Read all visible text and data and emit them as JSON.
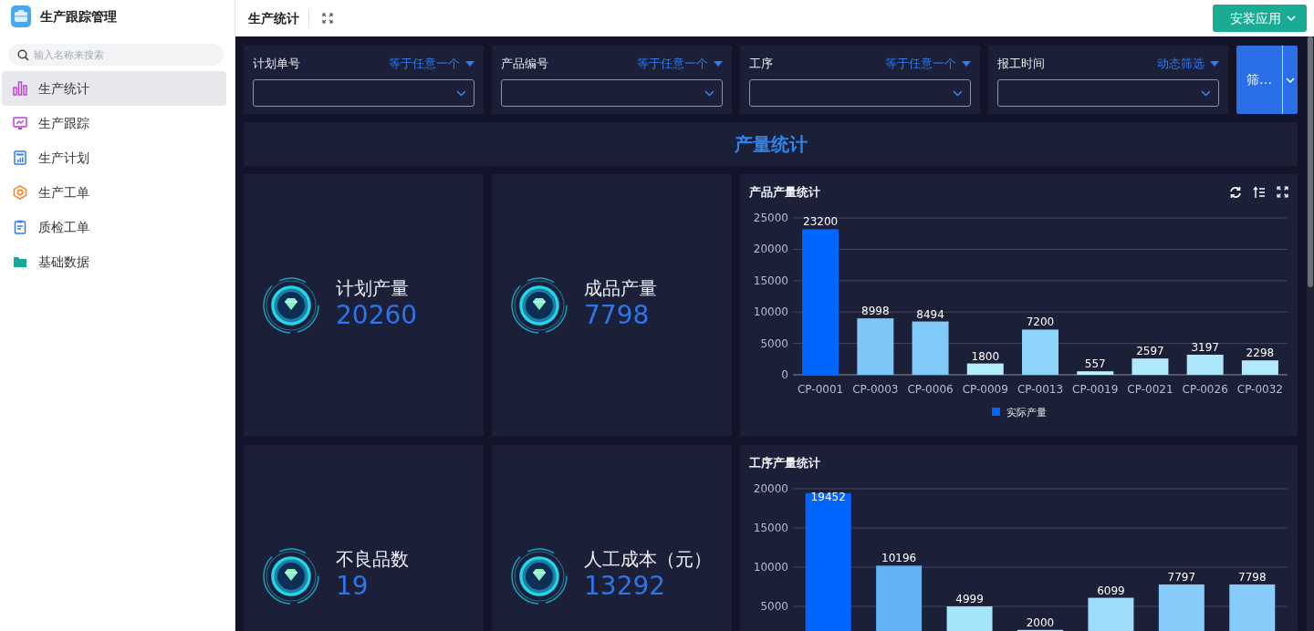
{
  "app": {
    "title": "生产跟踪管理"
  },
  "search": {
    "placeholder": "输入名称来搜索"
  },
  "sidebar": {
    "items": [
      {
        "label": "生产统计",
        "selected": true
      },
      {
        "label": "生产跟踪",
        "selected": false
      },
      {
        "label": "生产计划",
        "selected": false
      },
      {
        "label": "生产工单",
        "selected": false
      },
      {
        "label": "质检工单",
        "selected": false
      },
      {
        "label": "基础数据",
        "selected": false
      }
    ]
  },
  "header": {
    "title": "生产统计",
    "button": "安装应用"
  },
  "filters": [
    {
      "label": "计划单号",
      "operator": "等于任意一个"
    },
    {
      "label": "产品编号",
      "operator": "等于任意一个"
    },
    {
      "label": "工序",
      "operator": "等于任意一个"
    },
    {
      "label": "报工时间",
      "operator": "动态筛选"
    }
  ],
  "filter_button": "筛…",
  "section_title": "产量统计",
  "stats": [
    {
      "label": "计划产量",
      "value": "20260"
    },
    {
      "label": "成品产量",
      "value": "7798"
    },
    {
      "label": "不良品数",
      "value": "19"
    },
    {
      "label": "人工成本（元）",
      "value": "13292"
    }
  ],
  "charts": [
    {
      "title": "产品产量统计",
      "chart_data": {
        "type": "bar",
        "categories": [
          "CP-0001",
          "CP-0003",
          "CP-0006",
          "CP-0009",
          "CP-0013",
          "CP-0019",
          "CP-0021",
          "CP-0026",
          "CP-0032"
        ],
        "series": [
          {
            "name": "实际产量",
            "color": "#0066ff",
            "colors": [
              "#0066ff",
              "#7cc6f8",
              "#80c9f9",
              "#b4ecfb",
              "#8dd3fa",
              "#b8f0fb",
              "#b0e9fb",
              "#abe6fb",
              "#b1eafb"
            ],
            "values": [
              23200,
              8998,
              8494,
              1800,
              7200,
              557,
              2597,
              3197,
              2298
            ]
          }
        ],
        "ylim": [
          0,
          25000
        ],
        "yticks": [
          0,
          5000,
          10000,
          15000,
          20000,
          25000
        ],
        "grid": true,
        "data_labels": true
      }
    },
    {
      "title": "工序产量统计",
      "chart_data": {
        "type": "bar",
        "series": [
          {
            "colors": [
              "#0066ff",
              "#64b2f6",
              "#a6e4fb",
              "#b8f0fb",
              "#9ddcfb",
              "#86cbf9",
              "#86cbf9"
            ],
            "values": [
              19452,
              10196,
              4999,
              2000,
              6099,
              7797,
              7798
            ]
          }
        ],
        "ylim": [
          0,
          20000
        ],
        "yticks": [
          5000,
          10000,
          15000,
          20000
        ],
        "grid": true,
        "data_labels": true
      }
    }
  ]
}
